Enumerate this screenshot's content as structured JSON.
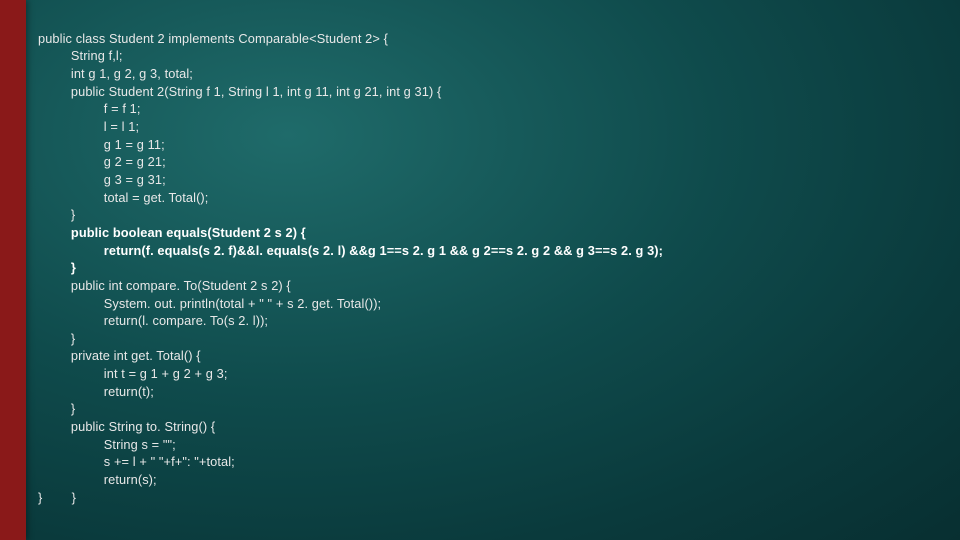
{
  "code": {
    "l01": "public class Student 2 implements Comparable<Student 2> {",
    "l02": "         String f,l;",
    "l03": "         int g 1, g 2, g 3, total;",
    "l04": "         public Student 2(String f 1, String l 1, int g 11, int g 21, int g 31) {",
    "l05": "                  f = f 1;",
    "l06": "                  l = l 1;",
    "l07": "                  g 1 = g 11;",
    "l08": "                  g 2 = g 21;",
    "l09": "                  g 3 = g 31;",
    "l10": "                  total = get. Total();",
    "l11": "         }",
    "l12": "         public boolean equals(Student 2 s 2) {",
    "l13": "                  return(f. equals(s 2. f)&&l. equals(s 2. l) &&g 1==s 2. g 1 && g 2==s 2. g 2 && g 3==s 2. g 3);",
    "l14": "         }",
    "l15": "         public int compare. To(Student 2 s 2) {",
    "l16": "                  System. out. println(total + \" \" + s 2. get. Total());",
    "l17": "                  return(l. compare. To(s 2. l));",
    "l18": "         }",
    "l19": "         private int get. Total() {",
    "l20": "                  int t = g 1 + g 2 + g 3;",
    "l21": "                  return(t);",
    "l22": "         }",
    "l23": "         public String to. String() {",
    "l24": "                  String s = \"\";",
    "l25": "                  s += l + \" \"+f+\": \"+total;",
    "l26": "                  return(s);",
    "l27": "}        }"
  }
}
